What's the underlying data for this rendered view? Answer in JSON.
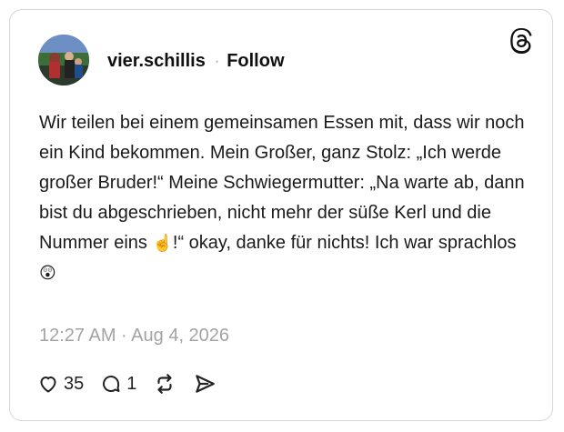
{
  "post": {
    "username": "vier.schillis",
    "separator": "·",
    "follow_label": "Follow",
    "text_parts": [
      "Wir teilen bei einem gemeinsamen Essen mit, dass wir noch ein Kind bekommen. Mein Großer, ganz Stolz: „Ich werde großer Bruder!“ Meine Schwiegermutter: „Na warte ab, dann bist du abgeschrieben, nicht mehr der süße Kerl und die Nummer eins ",
      "☝️",
      "!“ okay, danke für nichts! Ich war sprachlos ",
      "😲"
    ],
    "timestamp": "12:27 AM · Aug 4, 2026",
    "likes": "35",
    "replies": "1"
  },
  "icons": {
    "logo": "threads-logo-icon",
    "like": "heart-icon",
    "reply": "comment-icon",
    "repost": "repost-icon",
    "share": "share-icon"
  }
}
